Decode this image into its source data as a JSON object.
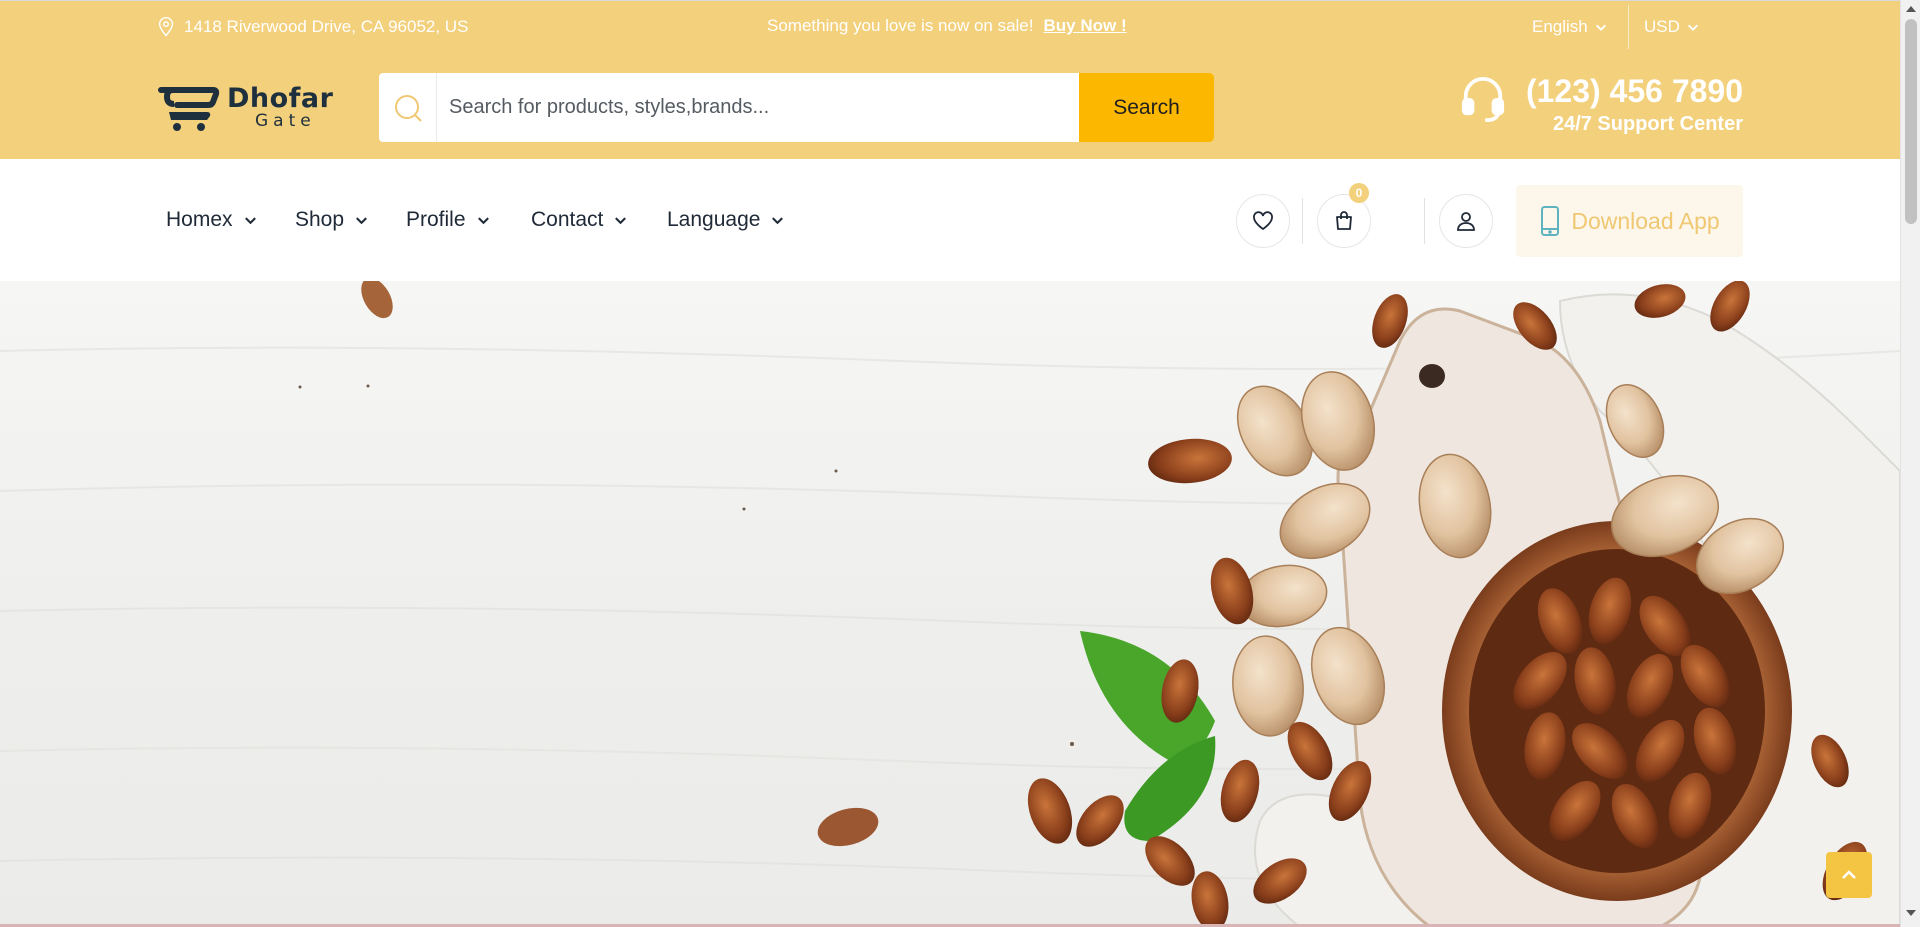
{
  "topbar": {
    "address": "1418 Riverwood Drive, CA 96052, US",
    "promo_text": "Something you love is now on sale!",
    "promo_link": "Buy Now !",
    "language": "English",
    "currency": "USD"
  },
  "brand": {
    "name": "Dhofar",
    "tagline": "Gate"
  },
  "search": {
    "placeholder": "Search for products, styles,brands...",
    "button_label": "Search"
  },
  "support": {
    "phone": "(123) 456 7890",
    "label": "24/7 Support Center"
  },
  "nav": {
    "items": [
      {
        "label": "Homex"
      },
      {
        "label": "Shop"
      },
      {
        "label": "Profile"
      },
      {
        "label": "Contact"
      },
      {
        "label": "Language"
      }
    ]
  },
  "actions": {
    "cart_count": "0",
    "download_label": "Download App"
  },
  "icons": [
    "location-pin-icon",
    "search-icon",
    "headset-icon",
    "heart-icon",
    "shopping-bag-icon",
    "user-icon",
    "mobile-phone-icon",
    "chevron-down-icon",
    "chevron-up-icon"
  ],
  "colors": {
    "topbar_bg": "#f3d07b",
    "search_button": "#fcb700",
    "download_bg": "#fcf7ea",
    "download_text": "#f0c772",
    "brand_dark": "#1e2f3e"
  }
}
